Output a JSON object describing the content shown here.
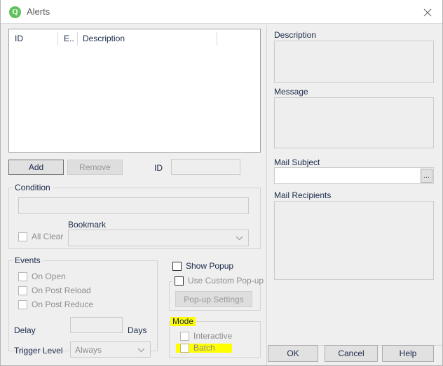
{
  "window": {
    "title": "Alerts",
    "app_icon": "qlik-icon",
    "icon_letter": "Q",
    "close_icon": "close-icon",
    "accent_color": "#5ec15b",
    "highlight_color": "#ffff00",
    "background": "#efefef"
  },
  "alert_list": {
    "columns": [
      "ID",
      "E..",
      "Description"
    ],
    "rows": []
  },
  "buttons": {
    "add": "Add",
    "remove": "Remove",
    "popup_settings": "Pop-up Settings",
    "ok": "OK",
    "cancel": "Cancel",
    "help": "Help",
    "ellipsis": "..."
  },
  "id_field": {
    "label": "ID",
    "value": "",
    "placeholder": ""
  },
  "condition": {
    "title": "Condition",
    "expression": "",
    "all_clear": {
      "label": "All Clear",
      "checked": false
    },
    "bookmark": {
      "label": "Bookmark",
      "value": "",
      "options": []
    }
  },
  "events": {
    "title": "Events",
    "checkboxes": [
      {
        "label": "On Open",
        "checked": false
      },
      {
        "label": "On Post Reload",
        "checked": false
      },
      {
        "label": "On Post Reduce",
        "checked": false
      }
    ],
    "delay": {
      "label": "Delay",
      "value": "",
      "unit": "Days"
    },
    "trigger_level": {
      "label": "Trigger Level",
      "value": "Always",
      "options": [
        "Always"
      ]
    }
  },
  "popup": {
    "show_popup": {
      "label": "Show Popup",
      "checked": false
    },
    "custom_popup": {
      "label": "Use Custom Pop-up",
      "checked": false
    }
  },
  "mode": {
    "title": "Mode",
    "title_highlighted": true,
    "options": [
      {
        "label": "Interactive",
        "checked": false,
        "highlighted": false
      },
      {
        "label": "Batch",
        "checked": false,
        "highlighted": true
      }
    ]
  },
  "right_panel": {
    "description": {
      "label": "Description",
      "value": ""
    },
    "message": {
      "label": "Message",
      "value": ""
    },
    "mail_subject": {
      "label": "Mail Subject",
      "value": ""
    },
    "mail_recipients": {
      "label": "Mail Recipients",
      "value": ""
    }
  }
}
